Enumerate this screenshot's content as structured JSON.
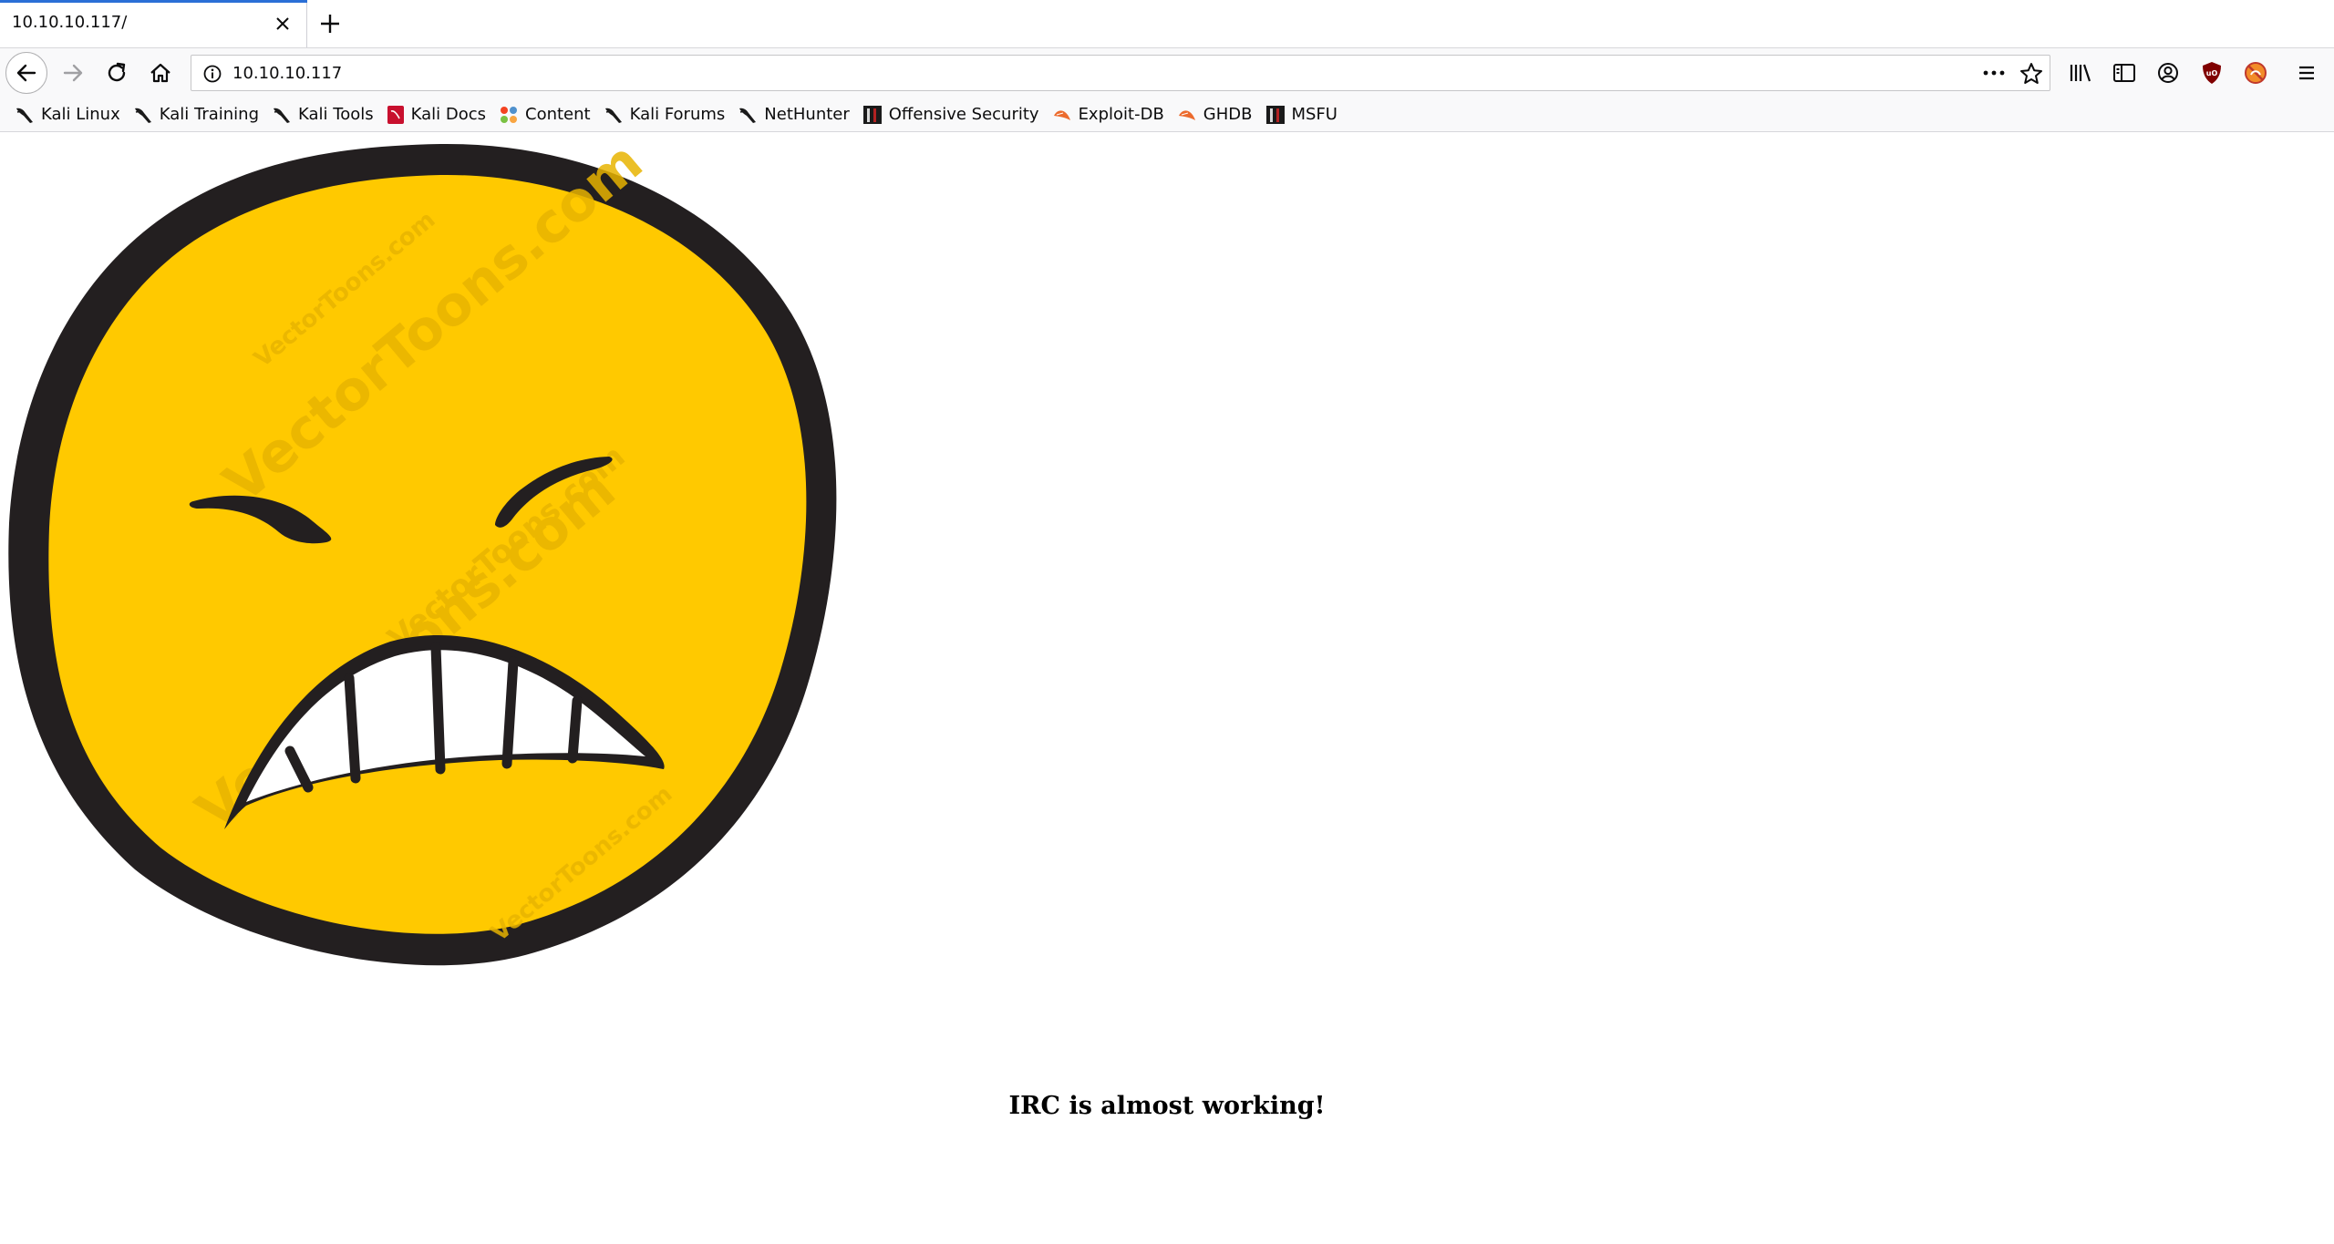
{
  "window": {
    "tab_title": "10.10.10.117/",
    "url": "10.10.10.117"
  },
  "toolbar": {
    "icons": [
      "back-arrow-icon",
      "forward-arrow-icon",
      "reload-icon",
      "home-icon",
      "info-icon",
      "more-actions-icon",
      "bookmark-star-icon",
      "library-icon",
      "sidebar-icon",
      "account-icon",
      "ublock-icon",
      "extension-icon",
      "hamburger-menu-icon"
    ],
    "accent_color": "#2a6fd6"
  },
  "bookmarks": [
    {
      "label": "Kali Linux",
      "icon": "kali-dragon-icon"
    },
    {
      "label": "Kali Training",
      "icon": "kali-dragon-icon"
    },
    {
      "label": "Kali Tools",
      "icon": "kali-dragon-icon"
    },
    {
      "label": "Kali Docs",
      "icon": "kali-docs-icon"
    },
    {
      "label": "Content",
      "icon": "joomla-icon"
    },
    {
      "label": "Kali Forums",
      "icon": "kali-dragon-icon"
    },
    {
      "label": "NetHunter",
      "icon": "kali-dragon-icon"
    },
    {
      "label": "Offensive Security",
      "icon": "offsec-icon"
    },
    {
      "label": "Exploit-DB",
      "icon": "exploitdb-icon"
    },
    {
      "label": "GHDB",
      "icon": "exploitdb-icon"
    },
    {
      "label": "MSFU",
      "icon": "offsec-icon"
    }
  ],
  "page": {
    "image": "angry-emoji-face",
    "watermark": "VectorToons.com",
    "heading": "IRC is almost working!",
    "face_color": "#ffc900",
    "outline_color": "#231f20"
  }
}
